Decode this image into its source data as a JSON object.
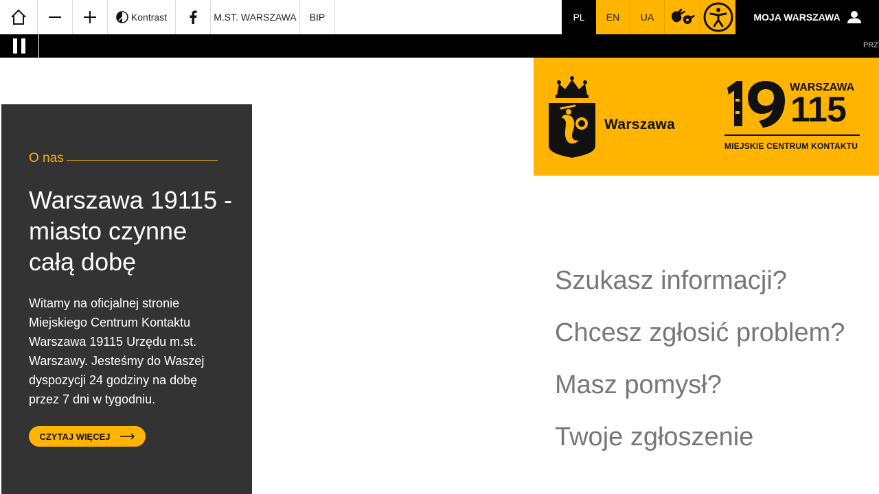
{
  "topbar": {
    "contrast_label": "Kontrast",
    "mst_label": "M.ST. WARSZAWA",
    "bip_label": "BIP",
    "lang_pl": "PL",
    "lang_en": "EN",
    "lang_ua": "UA",
    "account_label": "MOJA WARSZAWA",
    "icons": [
      "home-icon",
      "minus-icon",
      "plus-icon",
      "contrast-icon",
      "facebook-icon",
      "sign-language-icon",
      "accessibility-icon",
      "user-icon"
    ]
  },
  "ticker": {
    "text": "PRZY"
  },
  "banner": {
    "brand": "Warszawa",
    "logo_city": "WARSZAWA",
    "logo_number_a": "19",
    "logo_number_b": "115",
    "logo_subtitle": "MIEJSKIE CENTRUM KONTAKTU"
  },
  "card": {
    "eyebrow": "O nas",
    "title": "Warszawa 19115 - miasto czynne całą dobę",
    "body": "Witamy na oficjalnej stronie Miejskiego Centrum Kontaktu Warszawa 19115 Urzędu m.st. Warszawy. Jesteśmy do Waszej dyspozycji 24 godziny na dobę przez 7 dni w tygodniu.",
    "button_label": "CZYTAJ WIĘCEJ"
  },
  "questions": [
    "Szukasz informacji?",
    "Chcesz zgłosić problem?",
    "Masz pomysł?",
    "Twoje zgłoszenie"
  ],
  "colors": {
    "accent": "#ffb400",
    "dark": "#333333",
    "black": "#000000"
  }
}
